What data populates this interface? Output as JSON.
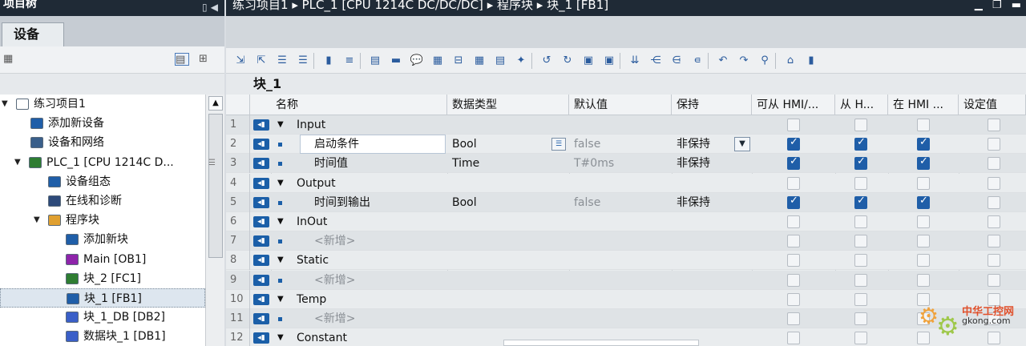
{
  "project_tree": {
    "title": "项目树",
    "tab": "设备",
    "items": [
      {
        "label": "练习项目1",
        "level": 0,
        "expanded": true
      },
      {
        "label": "添加新设备",
        "level": 1
      },
      {
        "label": "设备和网络",
        "level": 1
      },
      {
        "label": "PLC_1 [CPU 1214C D...",
        "level": 1,
        "expanded": true
      },
      {
        "label": "设备组态",
        "level": 2
      },
      {
        "label": "在线和诊断",
        "level": 2
      },
      {
        "label": "程序块",
        "level": 2,
        "expanded": true
      },
      {
        "label": "添加新块",
        "level": 3
      },
      {
        "label": "Main [OB1]",
        "level": 3
      },
      {
        "label": "块_2 [FC1]",
        "level": 3
      },
      {
        "label": "块_1 [FB1]",
        "level": 3,
        "selected": true
      },
      {
        "label": "块_1_DB [DB2]",
        "level": 3
      },
      {
        "label": "数据块_1 [DB1]",
        "level": 3
      }
    ]
  },
  "editor": {
    "breadcrumb": [
      "练习项目1",
      "PLC_1 [CPU 1214C DC/DC/DC]",
      "程序块",
      "块_1 [FB1]"
    ],
    "block_name": "块_1",
    "columns": [
      "名称",
      "数据类型",
      "默认值",
      "保持",
      "可从 HMI/...",
      "从 H...",
      "在 HMI ...",
      "设定值"
    ],
    "rows": [
      {
        "num": "1",
        "name": "Input",
        "section": true,
        "type": "",
        "default": "",
        "retain": "",
        "hmi1": false,
        "hmi2": false,
        "hmi3": false,
        "set": false
      },
      {
        "num": "2",
        "name": "启动条件",
        "section": false,
        "type": "Bool",
        "default": "false",
        "retain": "非保持",
        "hmi1": true,
        "hmi2": true,
        "hmi3": true,
        "set": false,
        "editing": true
      },
      {
        "num": "3",
        "name": "时间值",
        "section": false,
        "type": "Time",
        "default": "T#0ms",
        "retain": "非保持",
        "hmi1": true,
        "hmi2": true,
        "hmi3": true,
        "set": false
      },
      {
        "num": "4",
        "name": "Output",
        "section": true,
        "type": "",
        "default": "",
        "retain": "",
        "hmi1": false,
        "hmi2": false,
        "hmi3": false,
        "set": false
      },
      {
        "num": "5",
        "name": "时间到输出",
        "section": false,
        "type": "Bool",
        "default": "false",
        "retain": "非保持",
        "hmi1": true,
        "hmi2": true,
        "hmi3": true,
        "set": false
      },
      {
        "num": "6",
        "name": "InOut",
        "section": true,
        "type": "",
        "default": "",
        "retain": "",
        "hmi1": false,
        "hmi2": false,
        "hmi3": false,
        "set": false
      },
      {
        "num": "7",
        "name": "<新增>",
        "section": false,
        "placeholder": true,
        "type": "",
        "default": "",
        "retain": "",
        "hmi1": false,
        "hmi2": false,
        "hmi3": false,
        "set": false
      },
      {
        "num": "8",
        "name": "Static",
        "section": true,
        "type": "",
        "default": "",
        "retain": "",
        "hmi1": false,
        "hmi2": false,
        "hmi3": false,
        "set": false
      },
      {
        "num": "9",
        "name": "<新增>",
        "section": false,
        "placeholder": true,
        "type": "",
        "default": "",
        "retain": "",
        "hmi1": false,
        "hmi2": false,
        "hmi3": false,
        "set": false
      },
      {
        "num": "10",
        "name": "Temp",
        "section": true,
        "type": "",
        "default": "",
        "retain": "",
        "hmi1": false,
        "hmi2": false,
        "hmi3": false,
        "set": false
      },
      {
        "num": "11",
        "name": "<新增>",
        "section": false,
        "placeholder": true,
        "type": "",
        "default": "",
        "retain": "",
        "hmi1": false,
        "hmi2": false,
        "hmi3": false,
        "set": false
      },
      {
        "num": "12",
        "name": "Constant",
        "section": true,
        "type": "",
        "default": "",
        "retain": "",
        "hmi1": false,
        "hmi2": false,
        "hmi3": false,
        "set": false
      }
    ]
  },
  "watermark": {
    "text": "中华工控网",
    "url": "gkong.com"
  },
  "colors": {
    "title_bar": "#1f2a36",
    "checked": "#1f5ea8",
    "selected_row": "#dde6ef"
  }
}
